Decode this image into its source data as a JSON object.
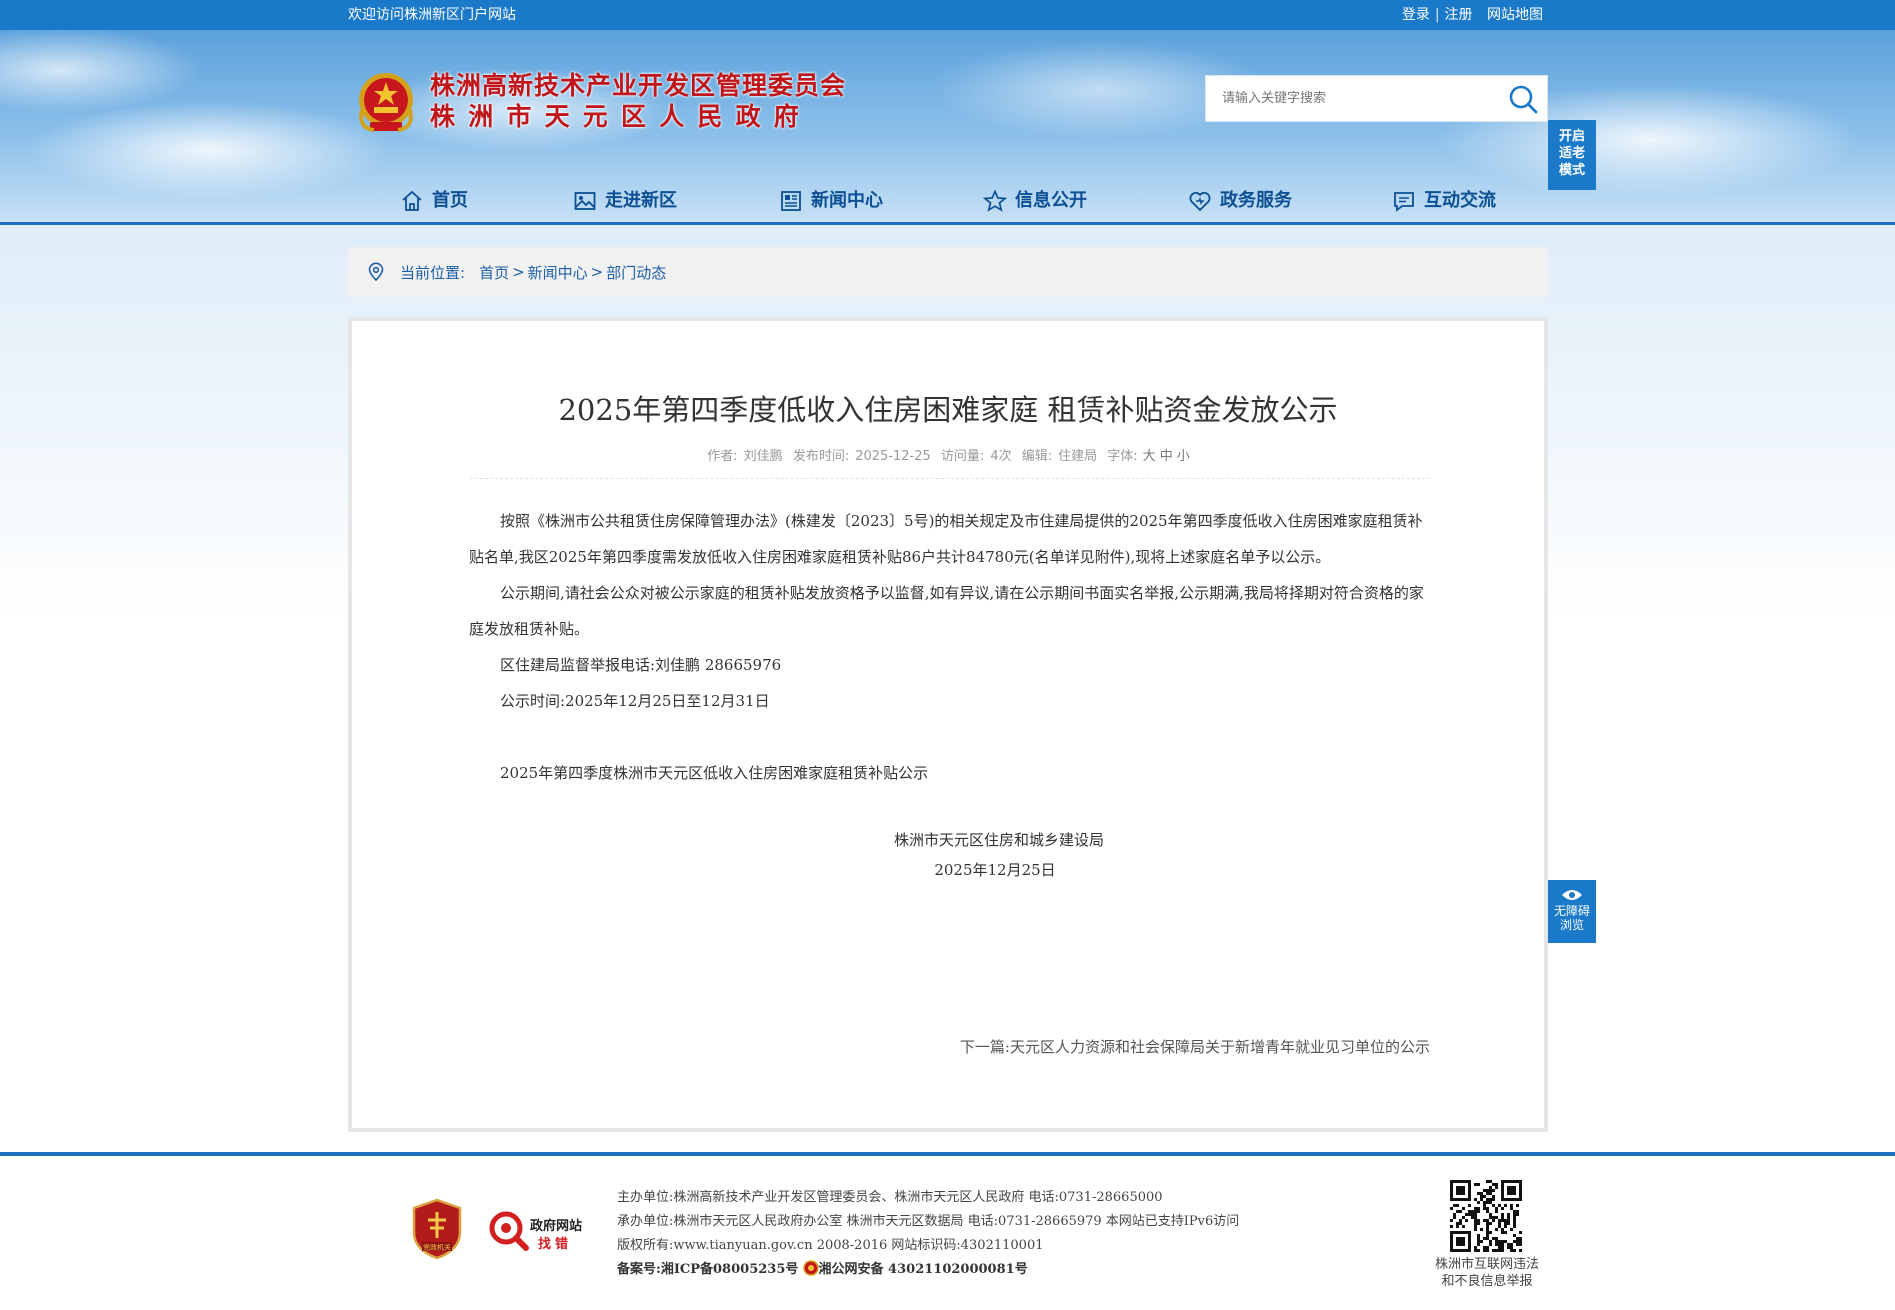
{
  "topbar": {
    "welcome": "欢迎访问株洲新区门户网站",
    "login": "登录",
    "separator": "|",
    "register": "注册",
    "sitemap": "网站地图"
  },
  "header": {
    "title_line1": "株洲高新技术产业开发区管理委员会",
    "title_line2": "株洲市天元区人民政府",
    "search_placeholder": "请输入关键字搜索",
    "elder_mode": [
      "开启",
      "适老",
      "模式"
    ]
  },
  "nav": [
    {
      "label": "首页",
      "icon": "home-icon"
    },
    {
      "label": "走进新区",
      "icon": "picture-icon"
    },
    {
      "label": "新闻中心",
      "icon": "newspaper-icon"
    },
    {
      "label": "信息公开",
      "icon": "star-icon"
    },
    {
      "label": "政务服务",
      "icon": "heart-icon"
    },
    {
      "label": "互动交流",
      "icon": "chat-icon"
    }
  ],
  "breadcrumb": {
    "label": "当前位置:",
    "items": [
      "首页",
      "新闻中心",
      "部门动态"
    ],
    "arrow": ">"
  },
  "article": {
    "title": "2025年第四季度低收入住房困难家庭 租赁补贴资金发放公示",
    "meta": {
      "author_label": "作者:",
      "author": "刘佳鹏",
      "date_label": "发布时间:",
      "date": "2025-12-25",
      "views_label": "访问量:",
      "views": "4次",
      "editor_label": "编辑:",
      "editor": "住建局",
      "fontsize_label": "字体:",
      "fontsize_large": "大",
      "fontsize_medium": "中",
      "fontsize_small": "小"
    },
    "paragraphs": [
      "按照《株洲市公共租赁住房保障管理办法》(株建发〔2023〕5号)的相关规定及市住建局提供的2025年第四季度低收入住房困难家庭租赁补贴名单,我区2025年第四季度需发放低收入住房困难家庭租赁补贴86户共计84780元(名单详见附件),现将上述家庭名单予以公示。",
      "公示期间,请社会公众对被公示家庭的租赁补贴发放资格予以监督,如有异议,请在公示期间书面实名举报,公示期满,我局将择期对符合资格的家庭发放租赁补贴。",
      "区住建局监督举报电话:刘佳鹏 28665976",
      "公示时间:2025年12月25日至12月31日"
    ],
    "attachment": "2025年第四季度株洲市天元区低收入住房困难家庭租赁补贴公示",
    "signature_org": "株洲市天元区住房和城乡建设局",
    "signature_date": "2025年12月25日",
    "next_label": "下一篇:",
    "next_title": "天元区人力资源和社会保障局关于新增青年就业见习单位的公示"
  },
  "accessibility": {
    "line1": "无障碍",
    "line2": "浏览"
  },
  "footer": {
    "badge1_text": "党政机关",
    "badge2_line1": "政府网站",
    "badge2_line2": "找错",
    "host": "主办单位:株洲高新技术产业开发区管理委员会、株洲市天元区人民政府 电话:0731-28665000",
    "undertake": "承办单位:株洲市天元区人民政府办公室 株洲市天元区数据局 电话:0731-28665979 本网站已支持IPv6访问",
    "copyright": "版权所有:www.tianyuan.gov.cn 2008-2016 网站标识码:4302110001",
    "icp_label": "备案号:",
    "icp": "湘ICP备08005235号",
    "police": "湘公网安备 43021102000081号",
    "qr_caption_line1": "株洲市互联网违法",
    "qr_caption_line2": "和不良信息举报"
  },
  "colors": {
    "brand_blue": "#1a79c9",
    "nav_text": "#0d4f93",
    "title_red": "#c0161b"
  }
}
